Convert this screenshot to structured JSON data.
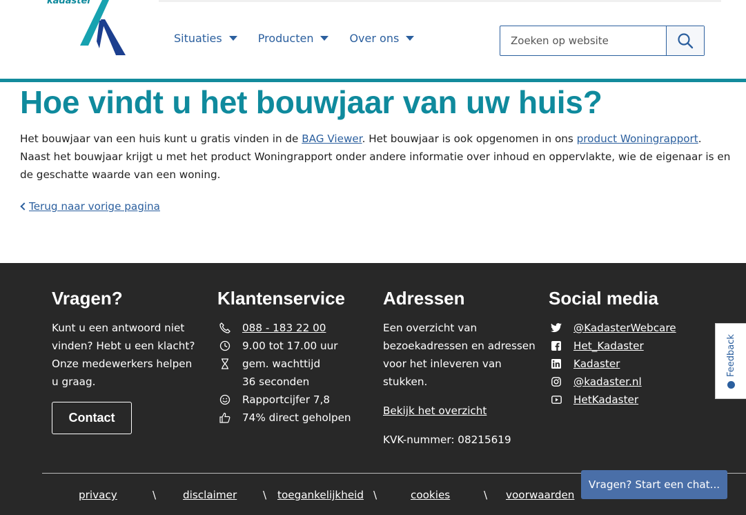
{
  "header": {
    "logo_text": "kadaster",
    "nav": [
      {
        "label": "Situaties"
      },
      {
        "label": "Producten"
      },
      {
        "label": "Over ons"
      }
    ],
    "search": {
      "placeholder": "Zoeken op website"
    }
  },
  "main": {
    "title": "Hoe vindt u het bouwjaar van uw huis?",
    "intro": {
      "part1": "Het bouwjaar van een huis kunt u gratis vinden in de ",
      "link1": "BAG Viewer",
      "part2": ". Het bouwjaar is ook opgenomen in ons ",
      "link2": "product Woningrapport",
      "part3": ". Naast het bouwjaar krijgt u met het product Woningrapport onder andere informatie over inhoud en oppervlakte, wie de eigenaar is en de geschatte waarde van een woning."
    },
    "back_link": "Terug naar vorige pagina"
  },
  "footer": {
    "vragen": {
      "title": "Vragen?",
      "text": "Kunt u een antwoord niet vinden? Hebt u een klacht? Onze medewerkers helpen u graag.",
      "button": "Contact"
    },
    "klantenservice": {
      "title": "Klantenservice",
      "phone": "088 - 183 22 00",
      "hours": "9.00 tot 17.00 uur",
      "wait_line1": "gem. wachttijd",
      "wait_line2": "36 seconden",
      "rating": "Rapportcijfer 7,8",
      "helped": "74% direct geholpen"
    },
    "adressen": {
      "title": "Adressen",
      "text": "Een overzicht van bezoekadressen en adressen voor het inleveren van stukken.",
      "link": "Bekijk het overzicht",
      "kvk": "KVK-nummer: 08215619"
    },
    "social": {
      "title": "Social media",
      "twitter": "@KadasterWebcare",
      "facebook": "Het_Kadaster",
      "linkedin": "Kadaster",
      "instagram": "@kadaster.nl",
      "youtube": "HetKadaster"
    },
    "bottom": {
      "privacy": "privacy",
      "disclaimer": "disclaimer",
      "toegankelijkheid": "toegankelijkheid",
      "cookies": "cookies",
      "voorwaarden": "voorwaarden",
      "sep": "\\"
    }
  },
  "feedback": {
    "label": "Feedback"
  },
  "chat": {
    "label": "Vragen? Start een chat..."
  },
  "colors": {
    "teal": "#0f8a9d",
    "link": "#2b5f9e",
    "footer_bg": "#282828",
    "chat_bg": "#4a6fa8"
  }
}
